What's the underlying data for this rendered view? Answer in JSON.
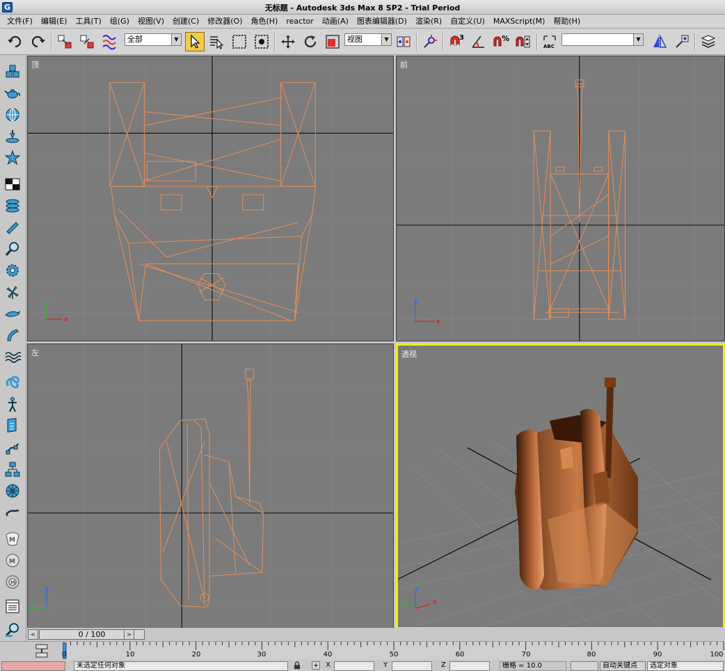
{
  "window": {
    "title": "无标题 - Autodesk 3ds Max 8 SP2  - Trial Period",
    "app_icon_letter": "G"
  },
  "menu": [
    "文件(F)",
    "编辑(E)",
    "工具(T)",
    "组(G)",
    "视图(V)",
    "创建(C)",
    "修改器(O)",
    "角色(H)",
    "reactor",
    "动画(A)",
    "图表编辑器(D)",
    "渲染(R)",
    "自定义(U)",
    "MAXScript(M)",
    "帮助(H)"
  ],
  "toolbar": {
    "selection_filter": "全部",
    "reference_coord": "视图",
    "snap_toggle_3_label": "3",
    "percent_snap_label": "%",
    "named_selection": ""
  },
  "viewports": {
    "top": {
      "label": "顶"
    },
    "front": {
      "label": "前"
    },
    "left": {
      "label": "左"
    },
    "perspective": {
      "label": "透视"
    }
  },
  "axes": {
    "x": "x",
    "y": "y",
    "z": "z"
  },
  "colors": {
    "viewport_bg": "#7b7b7b",
    "wire": "#e8905a",
    "active_border": "#f7ea12",
    "grid_line": "#000000"
  },
  "timeline": {
    "frame_display": "0 / 100",
    "prev": "<",
    "next": ">"
  },
  "ruler": {
    "ticks": [
      "0",
      "10",
      "20",
      "30",
      "40",
      "50",
      "60",
      "70",
      "80",
      "90",
      "100"
    ]
  },
  "status": {
    "selection_message": "未选定任何对象",
    "x_label": "X",
    "y_label": "Y",
    "z_label": "Z",
    "grid_label": "栅格 = 10.0",
    "auto_key": "自动关键点",
    "selected_dropdown": "选定对象"
  }
}
